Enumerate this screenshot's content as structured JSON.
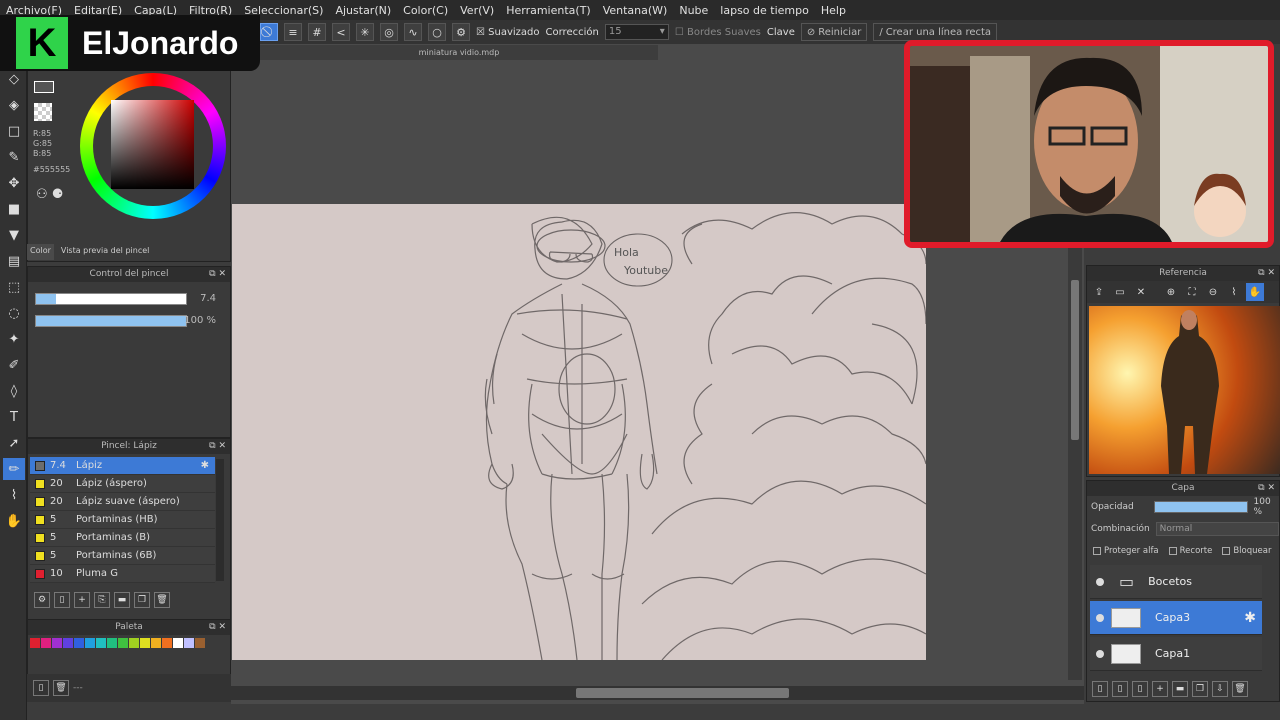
{
  "menu": [
    "Archivo(F)",
    "Editar(E)",
    "Capa(L)",
    "Filtro(R)",
    "Seleccionar(S)",
    "Ajustar(N)",
    "Color(C)",
    "Ver(V)",
    "Herramienta(T)",
    "Ventana(W)",
    "Nube",
    "lapso de tiempo",
    "Help"
  ],
  "logo": {
    "letter": "K",
    "name": "ElJonardo"
  },
  "toolbar": {
    "suavizado": "Suavizado",
    "correccion": "Corrección",
    "correccion_value": "15",
    "bordes": "Bordes Suaves",
    "clave": "Clave",
    "reiniciar": "Reiniciar",
    "linea": "Crear una línea recta"
  },
  "color": {
    "r": "R:85",
    "g": "G:85",
    "b": "B:85",
    "hex": "#555555",
    "tab_color": "Color",
    "tab_preview": "Vista previa del pincel"
  },
  "brush_control": {
    "title": "Control del pincel",
    "size": "7.4",
    "opacity": "100 %",
    "size_fraction": 0.13,
    "opacity_fraction": 1.0
  },
  "brush_list": {
    "title": "Pincel: Lápiz",
    "items": [
      {
        "size": "7.4",
        "name": "Lápiz",
        "color": "#6d6d6d",
        "selected": true
      },
      {
        "size": "20",
        "name": "Lápiz (áspero)",
        "color": "#f0e020"
      },
      {
        "size": "20",
        "name": "Lápiz suave (áspero)",
        "color": "#f0e020"
      },
      {
        "size": "5",
        "name": "Portaminas (HB)",
        "color": "#f0e020"
      },
      {
        "size": "5",
        "name": "Portaminas (B)",
        "color": "#f0e020"
      },
      {
        "size": "5",
        "name": "Portaminas (6B)",
        "color": "#f0e020"
      },
      {
        "size": "10",
        "name": "Pluma G",
        "color": "#e02030"
      }
    ]
  },
  "palette": {
    "title": "Paleta",
    "colors": [
      "#e02030",
      "#e02080",
      "#a030d0",
      "#6040e0",
      "#3060e0",
      "#20a0e0",
      "#20c0c0",
      "#20c080",
      "#40c040",
      "#a0d020",
      "#e0e020",
      "#f0b020",
      "#f07020",
      "#ffffff",
      "#c0c0ff",
      "#9a6030"
    ]
  },
  "canvas": {
    "doc_title": "miniatura vidio.mdp",
    "speech": "Hola\nYoutube"
  },
  "reference": {
    "title": "Referencia"
  },
  "layers": {
    "title": "Capa",
    "opacity_label": "Opacidad",
    "opacity_value": "100 %",
    "blend_label": "Combinación",
    "blend_value": "Normal",
    "proteger": "Proteger alfa",
    "recorte": "Recorte",
    "bloquear": "Bloquear",
    "items": [
      {
        "name": "Bocetos",
        "type": "folder"
      },
      {
        "name": "Capa3",
        "type": "layer",
        "selected": true
      },
      {
        "name": "Capa1",
        "type": "layer"
      }
    ]
  }
}
